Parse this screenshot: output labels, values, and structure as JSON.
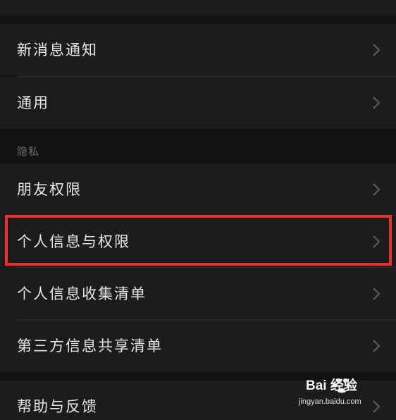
{
  "settings": {
    "items_top": [
      {
        "label": "新消息通知"
      },
      {
        "label": "通用"
      }
    ],
    "privacy_header": "隐私",
    "privacy_items": [
      {
        "label": "朋友权限"
      },
      {
        "label": "个人信息与权限"
      },
      {
        "label": "个人信息收集清单"
      },
      {
        "label": "第三方信息共享清单"
      }
    ],
    "items_bottom": [
      {
        "label": "帮助与反馈"
      }
    ]
  },
  "icons": {
    "row_arrow": "chevron-right-icon"
  },
  "highlight": {
    "target": "个人信息与权限",
    "color": "#e8312f"
  },
  "watermark": {
    "logo_text": "Bai  经验",
    "url": "jingyan.baidu.com"
  },
  "colors": {
    "background": "#111111",
    "cell": "#1c1c1c",
    "text": "#e6e6e6",
    "section_text": "#6f6f6f"
  }
}
